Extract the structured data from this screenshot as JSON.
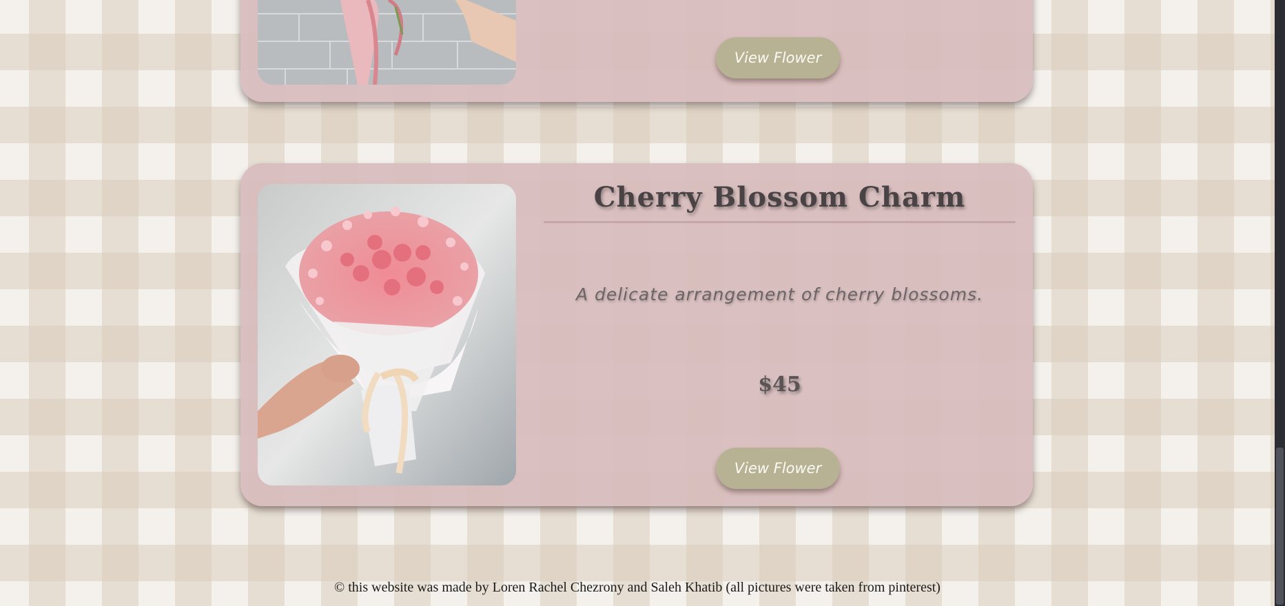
{
  "cards": [
    {
      "button_label": "View Flower",
      "image_icon": "bouquet-photo-pink-ribbon"
    },
    {
      "title": "Cherry Blossom Charm",
      "description": "A delicate arrangement of cherry blossoms.",
      "price": "$45",
      "button_label": "View Flower",
      "image_icon": "bouquet-photo-cherry-blossom"
    }
  ],
  "footer": {
    "text": "© this website was made by Loren Rachel Chezrony and Saleh Khatib (all pictures were taken from pinterest)"
  },
  "colors": {
    "card_background": "#d8bdbe",
    "button_background": "#b7b293",
    "title_text": "#4a4346",
    "page_check_light": "#f4f1ec",
    "page_check_dark": "#e2d7c8"
  }
}
